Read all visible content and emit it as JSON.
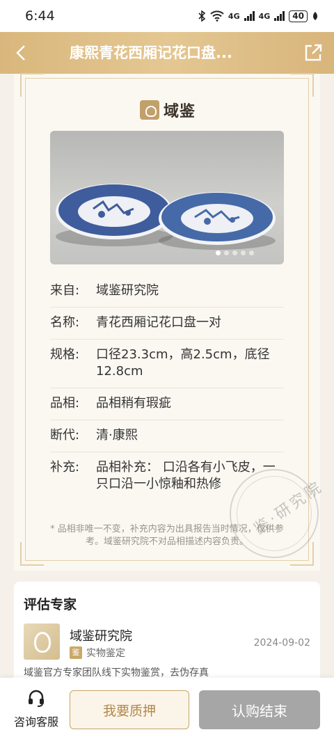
{
  "status_bar": {
    "time": "6:44",
    "network_1": "4G",
    "network_2": "4G",
    "battery": "40"
  },
  "header": {
    "title": "康熙青花西厢记花口盘...",
    "back_icon": "chevron-left-icon",
    "share_icon": "share-icon"
  },
  "brand": {
    "name": "域鉴"
  },
  "gallery": {
    "total_images": 5,
    "active_index": 0
  },
  "info": [
    {
      "label": "来自:",
      "value": "域鉴研究院"
    },
    {
      "label": "名称:",
      "value": "青花西厢记花口盘一对"
    },
    {
      "label": "规格:",
      "value": "口径23.3cm，高2.5cm，底径12.8cm"
    },
    {
      "label": "品相:",
      "value": "品相稍有瑕疵"
    },
    {
      "label": "断代:",
      "value": "清·康熙"
    },
    {
      "label": "补充:",
      "value": "品相补充： 口沿各有小飞皮，一只口沿一小惊釉和热修"
    }
  ],
  "note": "* 品相非唯一不变，补充内容为出具报告当时情况，仅供参考。域鉴研究院不对品相描述内容负责。",
  "seal": {
    "text": "鉴·研究院"
  },
  "expert": {
    "section_title": "评估专家",
    "name": "域鉴研究院",
    "badge_icon_text": "鉴",
    "badge_label": "实物鉴定",
    "date": "2024-09-02",
    "description": "域鉴官方专家团队线下实物鉴赏，去伪存真"
  },
  "bottom_bar": {
    "customer_service": "咨询客服",
    "pledge_button": "我要质押",
    "end_button": "认购结束"
  },
  "colors": {
    "header_gold": "#e4c792",
    "accent_gold": "#c7a367",
    "disabled_gray": "#a6a6a6"
  }
}
